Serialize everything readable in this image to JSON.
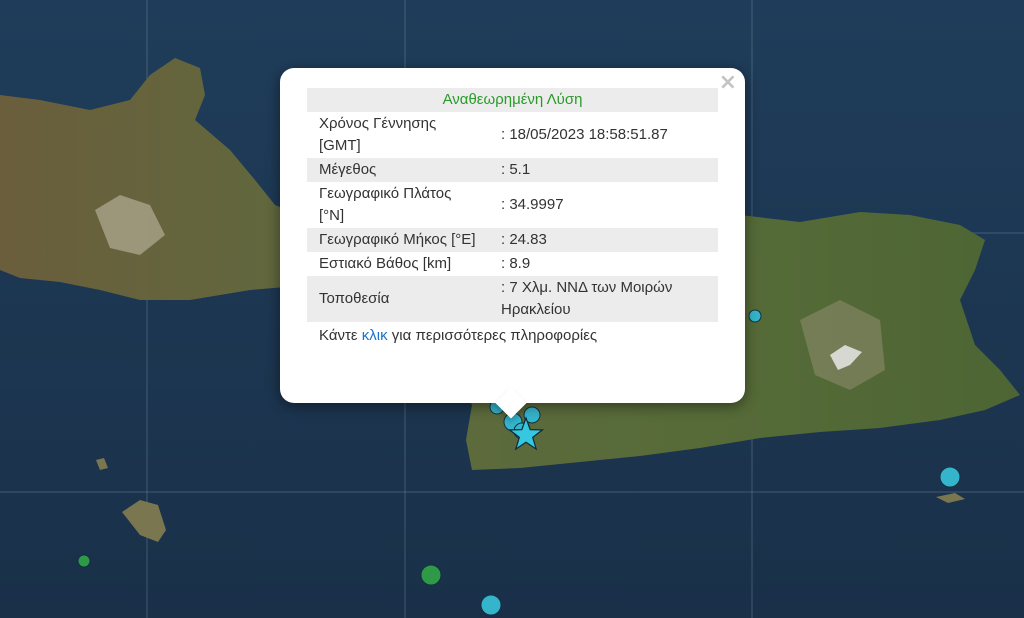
{
  "map": {
    "background_color": "#1c3550",
    "land_color": "#5b6b3c",
    "markers": [
      {
        "name": "marker-east-coast",
        "color": "#35b5cc",
        "size": "small"
      },
      {
        "name": "marker-southeast-sea",
        "color": "#35b5cc",
        "size": "medium"
      },
      {
        "name": "marker-south-sea",
        "color": "#35b5cc",
        "size": "medium"
      },
      {
        "name": "marker-green-large",
        "color": "#2e9a48",
        "size": "medium"
      },
      {
        "name": "marker-green-small",
        "color": "#2e9a48",
        "size": "small"
      }
    ],
    "epicenter_icon": "star-icon",
    "epicenter_color": "#35c8e0"
  },
  "popup": {
    "title": "Αναθεωρημένη Λύση",
    "close_label": "×",
    "rows": [
      {
        "label": "Χρόνος Γέννησης [GMT]",
        "value": ": 18/05/2023 18:58:51.87"
      },
      {
        "label": "Μέγεθος",
        "value": ": 5.1"
      },
      {
        "label": "Γεωγραφικό Πλάτος [°N]",
        "value": ": 34.9997"
      },
      {
        "label": "Γεωγραφικό Μήκος [°E]",
        "value": ": 24.83"
      },
      {
        "label": "Εστιακό Βάθος [km]",
        "value": ": 8.9"
      },
      {
        "label": "Τοποθεσία",
        "value": ": 7 Χλμ. ΝΝΔ των Μοιρών Ηρακλείου"
      }
    ],
    "more_prefix": "Κάντε ",
    "more_link": "κλικ",
    "more_suffix": " για περισσότερες πληροφορίες"
  }
}
